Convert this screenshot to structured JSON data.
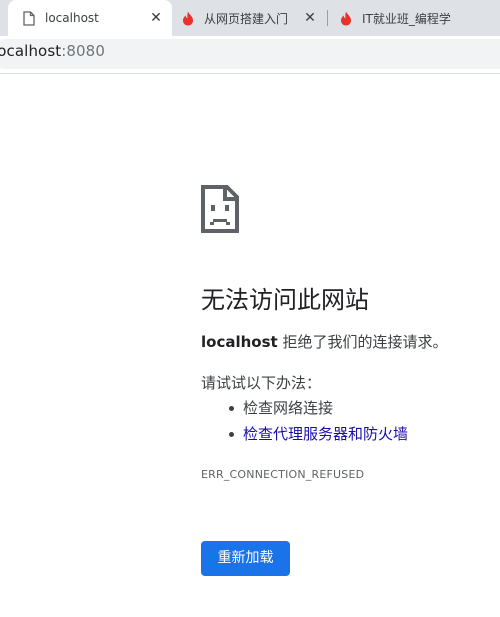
{
  "tabs": [
    {
      "title": "localhost",
      "icon": "page-icon",
      "active": true,
      "close_label": "✕"
    },
    {
      "title": "从网页搭建入门",
      "icon": "flame-icon",
      "active": false,
      "close_label": "✕"
    },
    {
      "title": "IT就业班_编程学",
      "icon": "flame-icon",
      "active": false,
      "close_label": ""
    }
  ],
  "address_bar": {
    "host": "localhost",
    "port": ":8080"
  },
  "error_page": {
    "icon": "sad-page-icon",
    "heading": "无法访问此网站",
    "host_bold": "localhost",
    "message": " 拒绝了我们的连接请求。",
    "suggestions_label": "请试试以下办法：",
    "suggestions": [
      {
        "text": "检查网络连接",
        "is_link": false
      },
      {
        "text": "检查代理服务器和防火墙",
        "is_link": true
      }
    ],
    "error_code": "ERR_CONNECTION_REFUSED",
    "reload_button": "重新加载"
  },
  "colors": {
    "link": "#1a0dab",
    "button": "#1a73e8",
    "favicon_flame": "#e8332a"
  }
}
